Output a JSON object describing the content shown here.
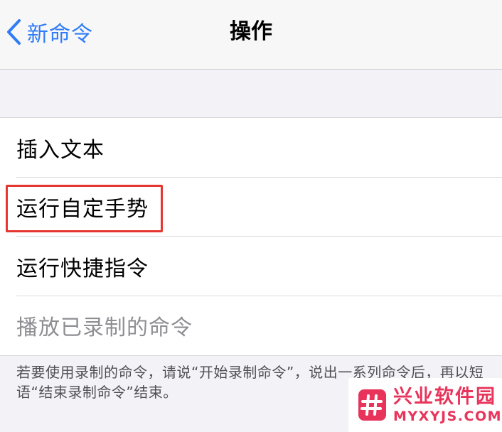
{
  "nav": {
    "back_label": "新命令",
    "title": "操作"
  },
  "actions": [
    {
      "label": "插入文本",
      "enabled": true
    },
    {
      "label": "运行自定手势",
      "enabled": true,
      "highlighted": true
    },
    {
      "label": "运行快捷指令",
      "enabled": true
    },
    {
      "label": "播放已录制的命令",
      "enabled": false
    }
  ],
  "footer": {
    "note": "若要使用录制的命令，请说“开始录制命令”，说出一系列命令后，再以短语“结束录制命令”结束。"
  },
  "watermark": {
    "title": "兴业软件园",
    "url": "MYXYJS.COM"
  },
  "colors": {
    "accent": "#2f7cf6",
    "highlight": "#e5362f",
    "watermark": "#e8345b",
    "disabled_text": "#8e8e93"
  },
  "icons": {
    "back": "chevron-left-icon",
    "watermark_logo": "hash-logo-icon"
  }
}
